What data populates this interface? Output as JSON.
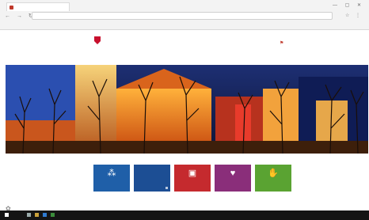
{
  "browser": {
    "tab_title": "",
    "address": "",
    "nav_glyphs": "← → ↻",
    "window_glyphs": "— ▢ ✕",
    "icon_glyphs": "☆ ⋮",
    "bookmarks": ""
  },
  "site": {
    "name": "",
    "subtitle": "",
    "nav": [
      "",
      "",
      "",
      "",
      "",
      ""
    ],
    "brand_color": "#c8102e"
  },
  "tiles": [
    {
      "label": "",
      "icon": "network-icon",
      "glyph": "⁂",
      "color": "#1f5fa8"
    },
    {
      "label": "",
      "icon": "document-icon",
      "glyph": "",
      "color": "#1c4e94"
    },
    {
      "label": "",
      "icon": "calendar-icon",
      "glyph": "▣",
      "color": "#c52a2e"
    },
    {
      "label": "",
      "icon": "heart-icon",
      "glyph": "♥",
      "color": "#8a2e7a"
    },
    {
      "label": "",
      "icon": "hand-icon",
      "glyph": "✋",
      "color": "#5aa332"
    }
  ],
  "widget_glyph": "✿",
  "taskbar": {
    "tray_text": ""
  }
}
